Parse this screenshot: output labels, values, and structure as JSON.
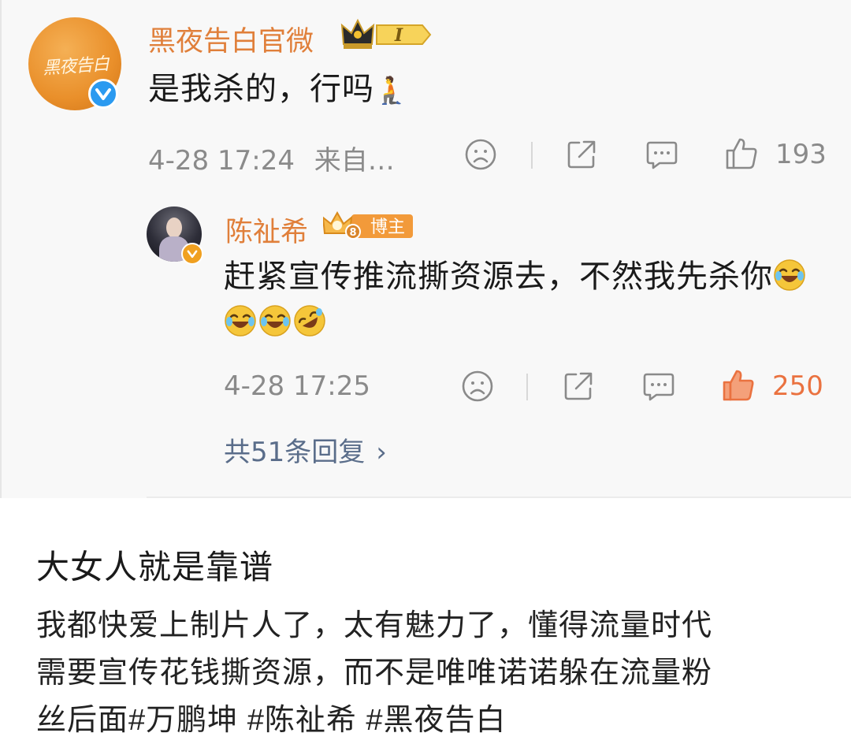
{
  "comment": {
    "username": "黑夜告白官微",
    "avatar_text": "黑夜告白",
    "badge_level": "I",
    "text": "是我杀的，行吗",
    "trailing_emoji": "🧎",
    "time": "4-28 17:24",
    "source": "来自…",
    "like_count": "193"
  },
  "reply": {
    "username": "陈祉希",
    "badge_label": "博主",
    "text": "赶紧宣传推流撕资源去，不然我先杀你",
    "time": "4-28 17:25",
    "like_count": "250"
  },
  "more_replies": "共51条回复",
  "post": {
    "title": "大女人就是靠谱",
    "lines": [
      "我都快爱上制片人了，太有魅力了，懂得流量时代",
      "需要宣传花钱撕资源，而不是唯唯诺诺躲在流量粉",
      "丝后面#万鹏坤 #陈祉希 #黑夜告白"
    ]
  },
  "colors": {
    "username": "#e07f3a",
    "meta": "#8a8a8a",
    "link": "#5a6d8a",
    "like_active": "#ea7240",
    "verified_blue": "#2b9af0"
  }
}
